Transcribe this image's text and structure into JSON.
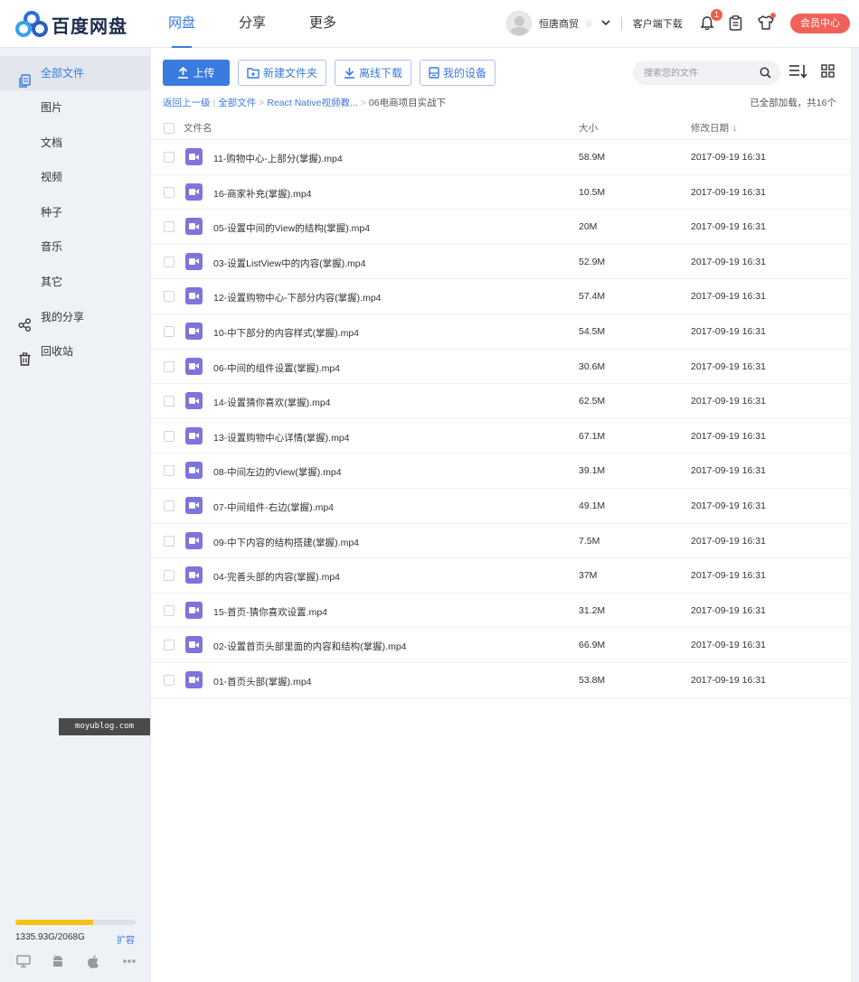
{
  "header": {
    "logo_text": "百度网盘",
    "nav": [
      {
        "label": "网盘",
        "active": true
      },
      {
        "label": "分享",
        "active": false
      },
      {
        "label": "更多",
        "active": false
      }
    ],
    "username": "恒唐商贸",
    "client_download": "客户端下载",
    "notification_count": "1",
    "vip_center": "会员中心",
    "accent_color": "#3a7bdf"
  },
  "sidebar": {
    "items": [
      {
        "label": "全部文件",
        "icon": "all-files-icon",
        "active": true
      },
      {
        "label": "图片"
      },
      {
        "label": "文档"
      },
      {
        "label": "视频"
      },
      {
        "label": "种子"
      },
      {
        "label": "音乐"
      },
      {
        "label": "其它"
      },
      {
        "label": "我的分享",
        "icon": "share-icon"
      },
      {
        "label": "回收站",
        "icon": "trash-icon"
      }
    ],
    "quota_text": "1335.93G/2068G",
    "quota_used_fraction": 0.646,
    "expand_label": "扩容",
    "device_icons": [
      "desktop-icon",
      "android-icon",
      "apple-icon",
      "more-icon"
    ]
  },
  "toolbar": {
    "upload": "上传",
    "new_folder": "新建文件夹",
    "offline_download": "离线下载",
    "my_devices": "我的设备",
    "search_placeholder": "搜索您的文件"
  },
  "breadcrumb": {
    "back": "返回上一级",
    "root": "全部文件",
    "parent": "React Native视频教...",
    "current": "06电商项目实战下",
    "loaded": "已全部加载，共16个"
  },
  "table": {
    "headers": {
      "name": "文件名",
      "size": "大小",
      "date": "修改日期"
    },
    "rows": [
      {
        "name": "11-购物中心-上部分(掌握).mp4",
        "size": "58.9M",
        "date": "2017-09-19 16:31"
      },
      {
        "name": "16-商家补充(掌握).mp4",
        "size": "10.5M",
        "date": "2017-09-19 16:31"
      },
      {
        "name": "05-设置中间的View的结构(掌握).mp4",
        "size": "20M",
        "date": "2017-09-19 16:31"
      },
      {
        "name": "03-设置ListView中的内容(掌握).mp4",
        "size": "52.9M",
        "date": "2017-09-19 16:31"
      },
      {
        "name": "12-设置购物中心-下部分内容(掌握).mp4",
        "size": "57.4M",
        "date": "2017-09-19 16:31"
      },
      {
        "name": "10-中下部分的内容样式(掌握).mp4",
        "size": "54.5M",
        "date": "2017-09-19 16:31"
      },
      {
        "name": "06-中间的组件设置(掌握).mp4",
        "size": "30.6M",
        "date": "2017-09-19 16:31"
      },
      {
        "name": "14-设置猜你喜欢(掌握).mp4",
        "size": "62.5M",
        "date": "2017-09-19 16:31"
      },
      {
        "name": "13-设置购物中心详情(掌握).mp4",
        "size": "67.1M",
        "date": "2017-09-19 16:31"
      },
      {
        "name": "08-中间左边的View(掌握).mp4",
        "size": "39.1M",
        "date": "2017-09-19 16:31"
      },
      {
        "name": "07-中间组件-右边(掌握).mp4",
        "size": "49.1M",
        "date": "2017-09-19 16:31"
      },
      {
        "name": "09-中下内容的结构搭建(掌握).mp4",
        "size": "7.5M",
        "date": "2017-09-19 16:31"
      },
      {
        "name": "04-完善头部的内容(掌握).mp4",
        "size": "37M",
        "date": "2017-09-19 16:31"
      },
      {
        "name": "15-首页-猜你喜欢设置.mp4",
        "size": "31.2M",
        "date": "2017-09-19 16:31"
      },
      {
        "name": "02-设置首页头部里面的内容和结构(掌握).mp4",
        "size": "66.9M",
        "date": "2017-09-19 16:31"
      },
      {
        "name": "01-首页头部(掌握).mp4",
        "size": "53.8M",
        "date": "2017-09-19 16:31"
      }
    ]
  },
  "watermark": "moyublog.com"
}
